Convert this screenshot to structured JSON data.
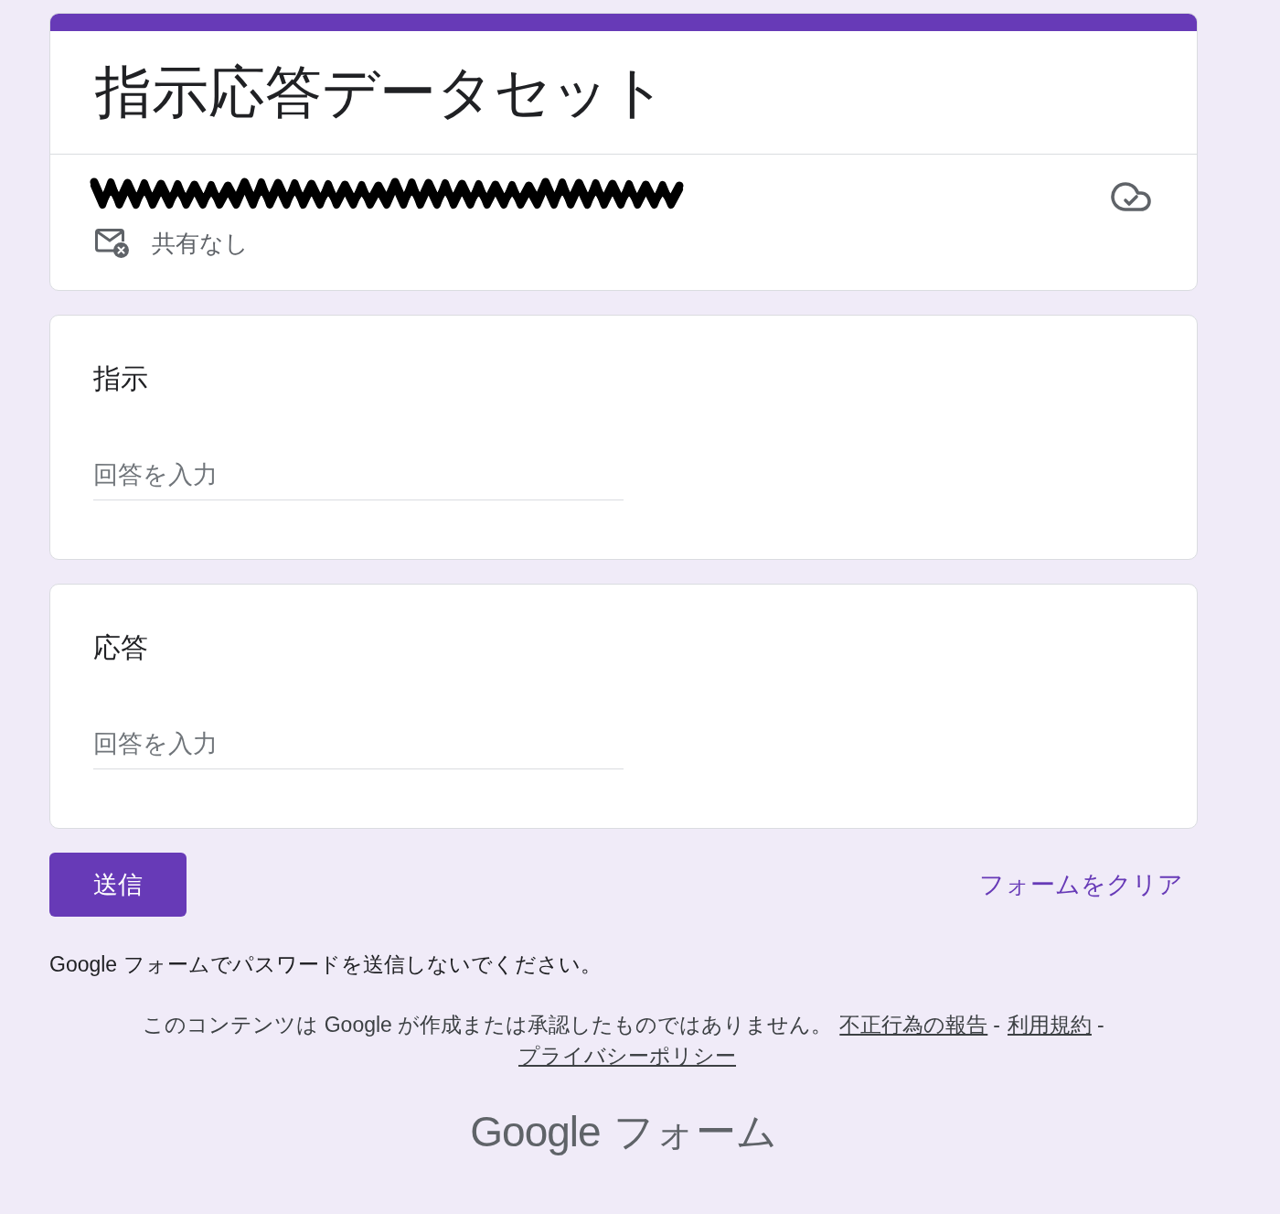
{
  "form_header": {
    "title": "指示応答データセット",
    "account_redacted": true,
    "sharing_status": "共有なし"
  },
  "questions": [
    {
      "label": "指示",
      "placeholder": "回答を入力"
    },
    {
      "label": "応答",
      "placeholder": "回答を入力"
    }
  ],
  "actions": {
    "submit_label": "送信",
    "clear_label": "フォームをクリア"
  },
  "footer": {
    "notice": "Google フォームでパスワードを送信しないでください。",
    "disclaimer": [
      {
        "kind": "text",
        "text": "このコンテンツは Google が作成または承認したものではありません。"
      },
      {
        "kind": "link",
        "text": "不正行為の報告"
      },
      {
        "kind": "separator",
        "text": "-"
      },
      {
        "kind": "link",
        "text": "利用規約"
      },
      {
        "kind": "separator",
        "text": "-"
      },
      {
        "kind": "link",
        "text": "プライバシーポリシー"
      }
    ]
  },
  "logo": {
    "brand": "Google",
    "product": "フォーム"
  }
}
